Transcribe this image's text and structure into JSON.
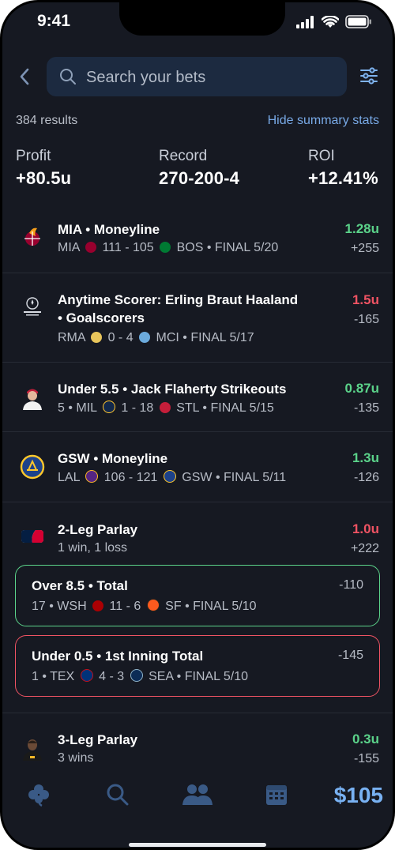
{
  "status_bar": {
    "time": "9:41"
  },
  "search": {
    "placeholder": "Search your bets"
  },
  "summary": {
    "results_count": "384 results",
    "hide_link": "Hide summary stats",
    "profit_label": "Profit",
    "profit_value": "+80.5u",
    "record_label": "Record",
    "record_value": "270-200-4",
    "roi_label": "ROI",
    "roi_value": "+12.41%"
  },
  "bets": [
    {
      "title": "MIA • Moneyline",
      "team1": "MIA",
      "score": "111 - 105",
      "team2": "BOS",
      "status": "• FINAL 5/20",
      "units": "1.28u",
      "odds": "+255",
      "result": "win"
    },
    {
      "title_line1": "Anytime Scorer: Erling Braut Haaland",
      "title_line2": "• Goalscorers",
      "team1": "RMA",
      "score": "0 - 4",
      "team2": "MCI",
      "status": "• FINAL 5/17",
      "units": "1.5u",
      "odds": "-165",
      "result": "loss",
      "logo_text": "CHAMPIONS LEAGUE"
    },
    {
      "title": "Under 5.5 • Jack Flaherty Strikeouts",
      "prefix": "5 •",
      "team1": "MIL",
      "score": "1 - 18",
      "team2": "STL",
      "status": "• FINAL 5/15",
      "units": "0.87u",
      "odds": "-135",
      "result": "win"
    },
    {
      "title": "GSW • Moneyline",
      "team1": "LAL",
      "score": "106 - 121",
      "team2": "GSW",
      "status": "• FINAL 5/11",
      "units": "1.3u",
      "odds": "-126",
      "result": "win"
    },
    {
      "title": "2-Leg Parlay",
      "summary": "1 win, 1 loss",
      "units": "1.0u",
      "odds": "+222",
      "result": "loss",
      "legs": [
        {
          "title": "Over 8.5 • Total",
          "prefix": "17 •",
          "team1": "WSH",
          "score": "11 - 6",
          "team2": "SF",
          "status": "• FINAL 5/10",
          "odds": "-110",
          "result": "win"
        },
        {
          "title": "Under 0.5 • 1st Inning Total",
          "prefix": "1 •",
          "team1": "TEX",
          "score": "4 - 3",
          "team2": "SEA",
          "status": "• FINAL 5/10",
          "odds": "-145",
          "result": "loss"
        }
      ]
    },
    {
      "title": "3-Leg Parlay",
      "summary": "3 wins",
      "units": "0.3u",
      "odds": "-155",
      "result": "win"
    }
  ],
  "tabbar": {
    "balance": "$105",
    "icons": [
      "clover-icon",
      "search-icon",
      "friends-icon",
      "calendar-icon"
    ]
  },
  "colors": {
    "win": "#5bd38a",
    "loss": "#ef5363",
    "accent": "#78b1f2",
    "background": "#161922"
  }
}
